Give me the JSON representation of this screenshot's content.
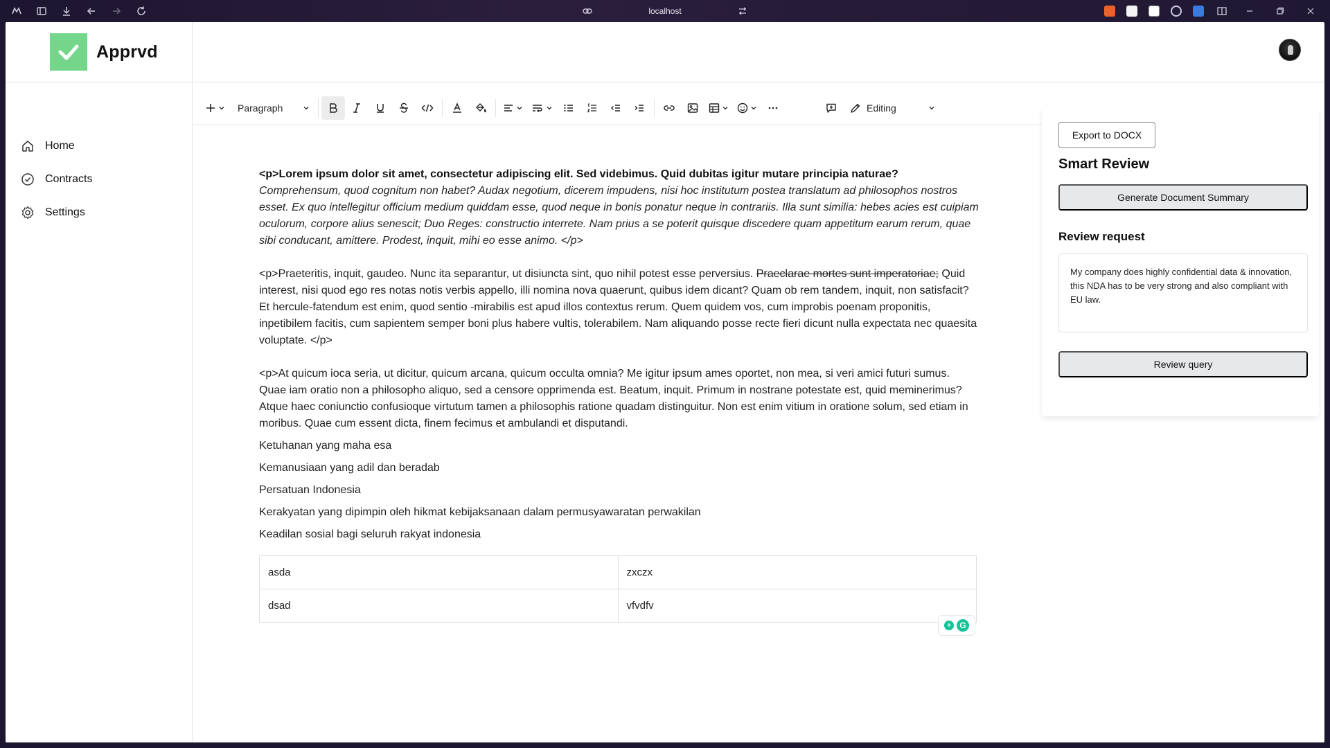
{
  "browser": {
    "url": "localhost"
  },
  "app": {
    "brand": "Apprvd",
    "nav": [
      {
        "label": "Home",
        "icon": "home-icon"
      },
      {
        "label": "Contracts",
        "icon": "check-circle-icon"
      },
      {
        "label": "Settings",
        "icon": "gear-icon"
      }
    ]
  },
  "toolbar": {
    "block_type": "Paragraph",
    "mode": "Editing"
  },
  "editor": {
    "p1_bold": "<p>Lorem ipsum dolor sit amet, consectetur adipiscing elit. Sed videbimus. Quid dubitas igitur mutare principia naturae?",
    "p1_italic": " Comprehensum, quod cognitum non habet? Audax negotium, dicerem impudens, nisi hoc institutum postea translatum ad philosophos nostros esset. Ex quo intellegitur officium medium quiddam esse, quod neque in bonis ponatur neque in contrariis. Illa sunt similia: hebes acies est cuipiam oculorum, corpore alius senescit; Duo Reges: constructio interrete. Nam prius a se poterit quisque discedere quam appetitum earum rerum, quae sibi conducant, amittere. Prodest, inquit, mihi eo esse animo. </p>",
    "p2_start": " <p>Praeteritis, inquit, gaudeo. Nunc ita separantur, ut disiuncta sint, quo nihil potest esse perversius. ",
    "p2_strike": "Praeclarae mortes sunt imperatoriae;",
    "p2_end": " Quid interest, nisi quod ego res notas notis verbis appello, illi nomina nova quaerunt, quibus idem dicant? Quam ob rem tandem, inquit, non satisfacit? Et hercule-fatendum est enim, quod sentio -mirabilis est apud illos contextus rerum. Quem quidem vos, cum improbis poenam proponitis, inpetibilem facitis, cum sapientem semper boni plus habere vultis, tolerabilem. Nam aliquando posse recte fieri dicunt nulla expectata nec quaesita voluptate. </p>",
    "p3": " <p>At quicum ioca seria, ut dicitur, quicum arcana, quicum occulta omnia? Me igitur ipsum ames oportet, non mea, si veri amici futuri sumus. Quae iam oratio non a philosopho aliquo, sed a censore opprimenda est. Beatum, inquit. Primum in nostrane potestate est, quid meminerimus? Atque haec coniunctio confusioque virtutum tamen a philosophis ratione quadam distinguitur. Non est enim vitium in oratione solum, sed etiam in moribus. Quae cum essent dicta, finem fecimus et ambulandi et disputandi.",
    "lines": [
      "Ketuhanan yang maha esa",
      "Kemanusiaan yang adil dan beradab",
      "Persatuan Indonesia",
      "Kerakyatan yang dipimpin oleh hikmat kebijaksanaan dalam permusyawaratan perwakilan",
      "Keadilan sosial bagi seluruh rakyat indonesia"
    ],
    "table": [
      [
        "asda",
        "zxczx"
      ],
      [
        "dsad",
        "vfvdfv"
      ]
    ]
  },
  "panel": {
    "export_label": "Export to DOCX",
    "smart_review_title": "Smart Review",
    "summary_button": "Generate Document Summary",
    "review_request_title": "Review request",
    "review_text": "My company does highly confidential data & innovation, this NDA has to be very strong and also compliant with EU law.",
    "review_button": "Review query"
  },
  "colors": {
    "logo_green": "#73d68a",
    "button_gray": "#e7e8ea",
    "chrome_bg": "#1c1630"
  }
}
